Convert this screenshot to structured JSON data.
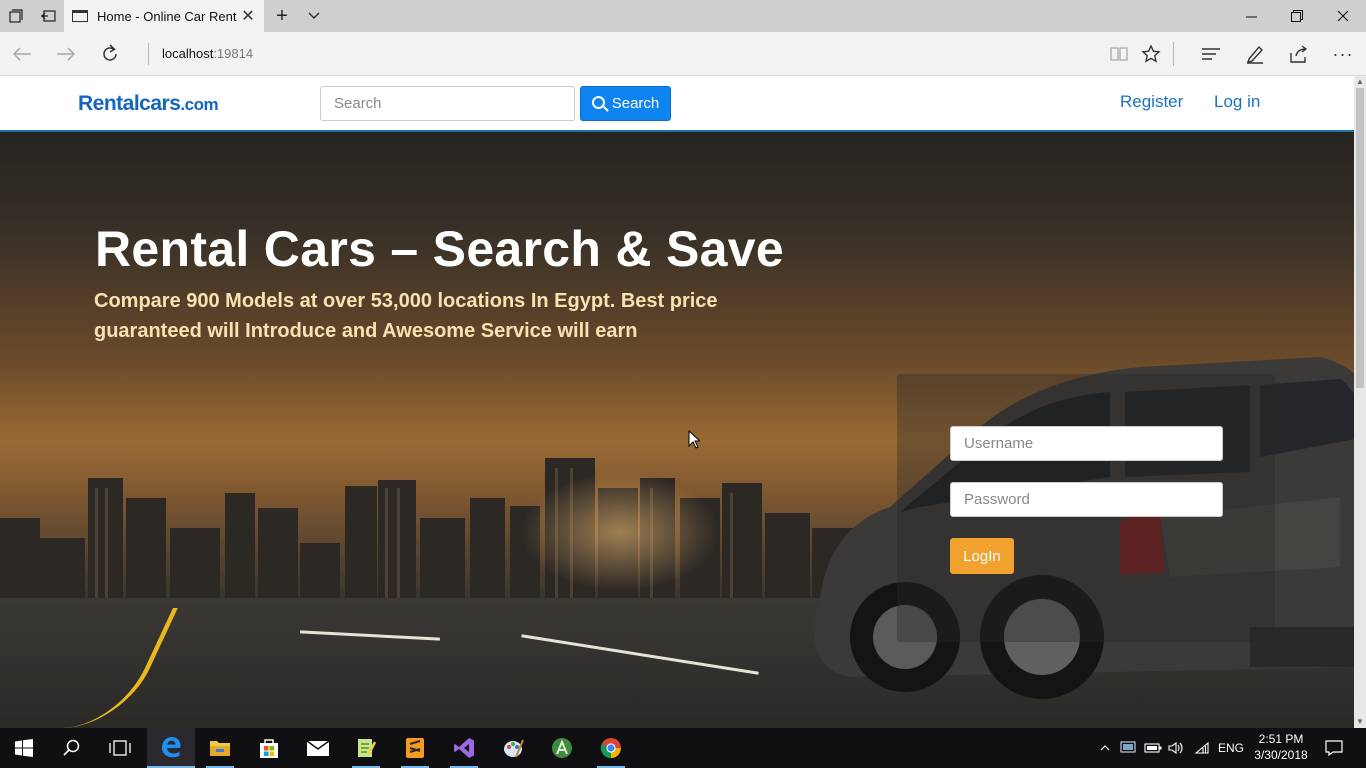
{
  "browser": {
    "tab_title": "Home - Online Car Rent",
    "address_host": "localhost",
    "address_port": ":19814"
  },
  "header": {
    "logo_main": "Rentalcars",
    "logo_suffix": ".com",
    "search_placeholder": "Search",
    "search_button": "Search",
    "register": "Register",
    "login": "Log in"
  },
  "hero": {
    "title": "Rental Cars – Search & Save",
    "subtitle": "Compare 900 Models at over 53,000 locations In Egypt. Best price guaranteed will Introduce and Awesome Service will earn"
  },
  "login_form": {
    "username_placeholder": "Username",
    "password_placeholder": "Password",
    "button": "LogIn"
  },
  "taskbar": {
    "lang": "ENG",
    "time": "2:51 PM",
    "date": "3/30/2018"
  }
}
